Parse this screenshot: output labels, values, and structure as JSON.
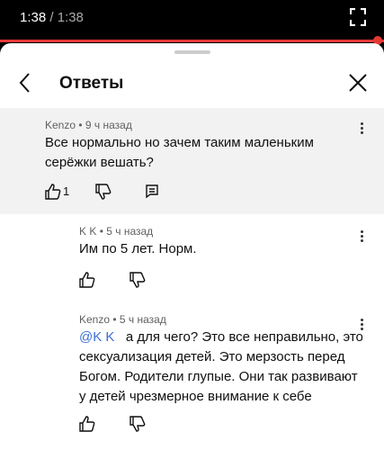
{
  "player": {
    "current_time": "1:38",
    "duration": "/ 1:38",
    "progress_percent": 100
  },
  "header": {
    "title": "Ответы"
  },
  "comments": [
    {
      "author": "Kenzo",
      "age": "• 9 ч назад",
      "text_line1": "Все нормально но зачем таким маленьким",
      "text_line2": "серёжки вешать?",
      "likes": "1"
    },
    {
      "author": "K K",
      "age": "• 5 ч назад",
      "text": "Им по 5 лет. Норм."
    },
    {
      "author": "Kenzo",
      "age": "• 5 ч назад",
      "mention": "@K K",
      "text_line1": "а для чего? Это все неправильно, это",
      "text_line2": "сексуализация детей. Это мерзость перед",
      "text_line3": "Богом. Родители глупые. Они так развивают",
      "text_line4": "у детей чрезмерное внимание к себе"
    }
  ],
  "icons": {
    "fullscreen": "fullscreen-icon",
    "back": "back-arrow-icon",
    "close": "close-icon",
    "like": "thumbs-up-icon",
    "dislike": "thumbs-down-icon",
    "reply": "reply-icon",
    "more": "more-vertical-icon"
  },
  "colors": {
    "progress": "#e53935",
    "mention": "#3b6fd8",
    "highlight_bg": "#f2f2f2"
  }
}
